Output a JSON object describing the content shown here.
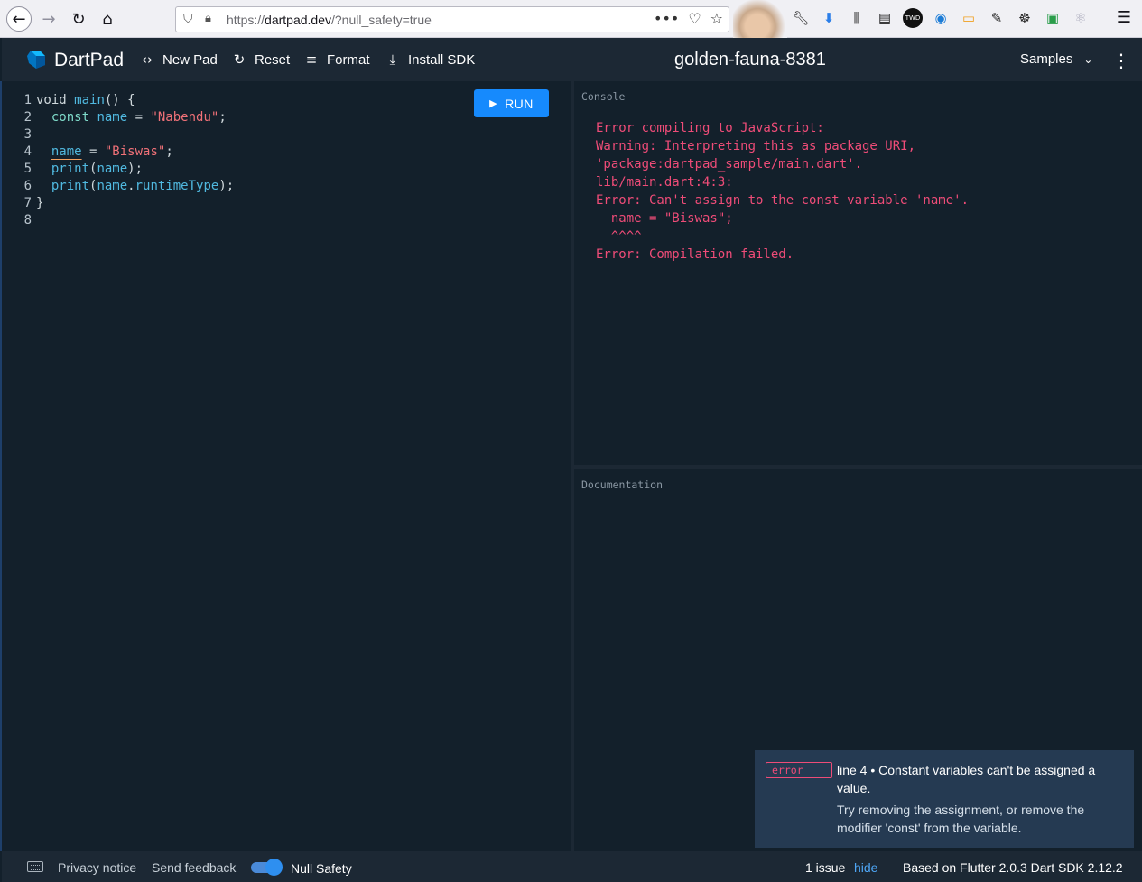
{
  "browser": {
    "url_prefix": "https://",
    "url_domain": "dartpad.dev",
    "url_path": "/?null_safety=true",
    "back_icon": "arrow-left-icon",
    "forward_icon": "arrow-right-icon",
    "reload_icon": "reload-icon",
    "home_icon": "home-icon"
  },
  "header": {
    "app_name": "DartPad",
    "new_pad": "New Pad",
    "reset": "Reset",
    "format": "Format",
    "install_sdk": "Install SDK",
    "pad_name": "golden-fauna-8381",
    "samples": "Samples"
  },
  "editor": {
    "run_label": "RUN",
    "lines": [
      "1",
      "2",
      "3",
      "4",
      "5",
      "6",
      "7",
      "8"
    ],
    "code": {
      "l1_void": "void ",
      "l1_main": "main",
      "l1_rest": "() {",
      "l2_const": "  const ",
      "l2_name": "name",
      "l2_eq": " = ",
      "l2_str": "\"Nabendu\"",
      "l2_end": ";",
      "l4_indent": "  ",
      "l4_name": "name",
      "l4_eq": " = ",
      "l4_str": "\"Biswas\"",
      "l4_end": ";",
      "l5_indent": "  ",
      "l5_print": "print",
      "l5_open": "(",
      "l5_name": "name",
      "l5_close": ");",
      "l6_indent": "  ",
      "l6_print": "print",
      "l6_open": "(",
      "l6_name": "name",
      "l6_dot": ".",
      "l6_rt": "runtimeType",
      "l6_close": ");",
      "l7": "}"
    }
  },
  "console": {
    "label": "Console",
    "output": "Error compiling to JavaScript:\nWarning: Interpreting this as package URI, \n'package:dartpad_sample/main.dart'.\nlib/main.dart:4:3:\nError: Can't assign to the const variable 'name'.\n  name = \"Biswas\";\n  ^^^^\nError: Compilation failed."
  },
  "documentation": {
    "label": "Documentation"
  },
  "issue": {
    "badge": "error",
    "message": "line 4 • Constant variables can't be assigned a value.",
    "fix": "Try removing the assignment, or remove the modifier 'const' from the variable."
  },
  "footer": {
    "privacy": "Privacy notice",
    "feedback": "Send feedback",
    "null_safety": "Null Safety",
    "issues": "1 issue",
    "hide": "hide",
    "version": "Based on Flutter 2.0.3 Dart SDK 2.12.2"
  },
  "colors": {
    "accent": "#168afd",
    "error": "#ef4c78",
    "background": "#13202b"
  }
}
